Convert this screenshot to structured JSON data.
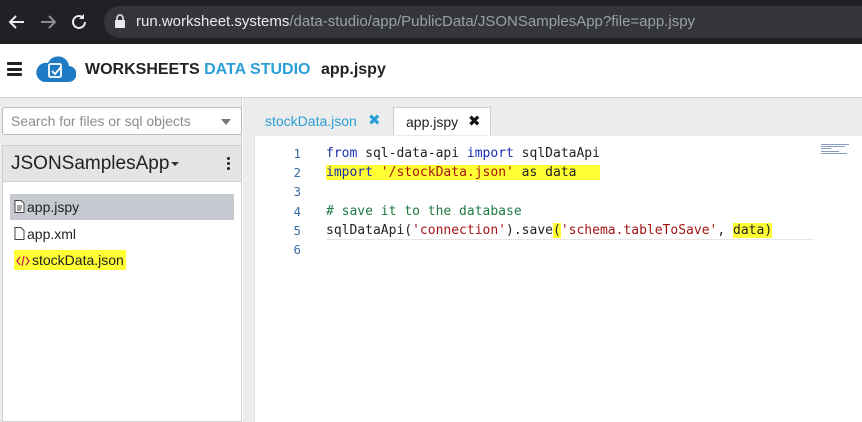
{
  "browser": {
    "url_host": "run.worksheet.systems",
    "url_path": "/data-studio/app/PublicData/JSONSamplesApp?file=app.jspy",
    "icons": [
      "back-arrow-icon",
      "forward-arrow-icon",
      "reload-icon",
      "lock-icon"
    ]
  },
  "header": {
    "brand_main": "WORKSHEETS",
    "brand_accent": "DATA STUDIO",
    "file_title": "app.jspy",
    "accent_color": "#2b9fd8"
  },
  "sidebar": {
    "search_placeholder": "Search for files or sql objects",
    "project_name": "JSONSamplesApp",
    "files": [
      {
        "name": "app.jspy",
        "icon": "file-text-icon",
        "selected": true
      },
      {
        "name": "app.xml",
        "icon": "file-icon"
      },
      {
        "name": "stockData.json",
        "icon": "code-icon",
        "highlighted": true
      }
    ]
  },
  "tabs": [
    {
      "label": "stockData.json",
      "active": false
    },
    {
      "label": "app.jspy",
      "active": true
    }
  ],
  "editor": {
    "line_numbers": [
      "1",
      "2",
      "3",
      "4",
      "5",
      "6"
    ],
    "lines": {
      "l1_kw1": "from",
      "l1_mod": " sql-data-api ",
      "l1_kw2": "import",
      "l1_name": " sqlDataApi",
      "l2_kw": "import",
      "l2_sp": " ",
      "l2_str": "'/stockData.json'",
      "l2_mid": " as ",
      "l2_name": "data",
      "l4_cmt": "# save it to the database",
      "l5_a": "sqlDataApi(",
      "l5_str1": "'connection'",
      "l5_b": ").save",
      "l5_paren": "(",
      "l5_str2": "'schema.tableToSave'",
      "l5_c": ", ",
      "l5_data": "data",
      "l5_close": ")"
    }
  }
}
